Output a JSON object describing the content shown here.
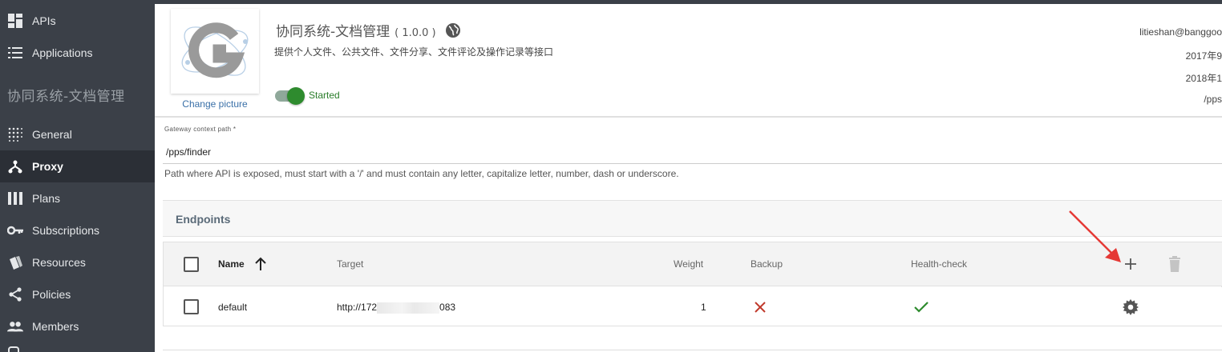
{
  "sidebar": {
    "items": [
      {
        "label": "APIs",
        "icon": "dashboard-icon"
      },
      {
        "label": "Applications",
        "icon": "list-icon"
      },
      {
        "label": "General",
        "icon": "grid-dots-icon"
      },
      {
        "label": "Proxy",
        "icon": "proxy-fork-icon"
      },
      {
        "label": "Plans",
        "icon": "columns-icon"
      },
      {
        "label": "Subscriptions",
        "icon": "key-icon"
      },
      {
        "label": "Resources",
        "icon": "resources-icon"
      },
      {
        "label": "Policies",
        "icon": "share-icon"
      },
      {
        "label": "Members",
        "icon": "people-icon"
      }
    ],
    "api_title": "协同系统-文档管理",
    "active": "Proxy"
  },
  "header": {
    "change_picture": "Change picture",
    "api_name": "协同系统-文档管理",
    "api_version": "( 1.0.0 )",
    "description": "提供个人文件、公共文件、文件分享、文件评论及操作记录等接口",
    "status": "Started",
    "owner": "litieshan@banggoo",
    "created": "2017年9",
    "updated": "2018年1",
    "context": "/pps"
  },
  "context_path": {
    "label": "Gateway context path *",
    "value": "/pps/finder",
    "hint": "Path where API is exposed, must start with a '/' and must contain any letter, capitalize letter, number, dash or underscore."
  },
  "endpoints": {
    "title": "Endpoints",
    "columns": {
      "name": "Name",
      "target": "Target",
      "weight": "Weight",
      "backup": "Backup",
      "health": "Health-check"
    },
    "rows": [
      {
        "name": "default",
        "target_prefix": "http://172",
        "target_suffix": "083",
        "weight": "1",
        "backup": false,
        "health_check": true
      }
    ]
  },
  "colors": {
    "sidebar_bg": "#3b4048",
    "sidebar_active": "#2b2f36",
    "accent_green": "#2e8b2e",
    "cross_red": "#c0392b",
    "annotation_arrow": "#e53935"
  }
}
